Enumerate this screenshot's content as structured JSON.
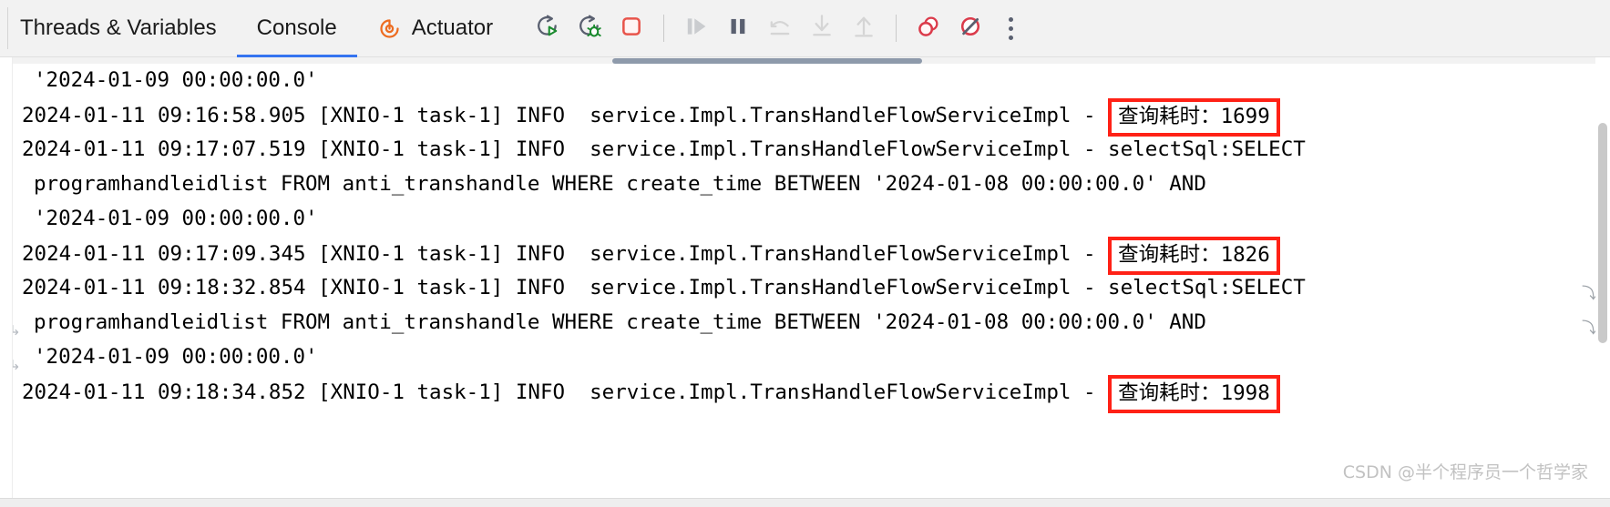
{
  "toolbar": {
    "tabs": [
      {
        "label": "Threads & Variables",
        "icon": null,
        "active": false
      },
      {
        "label": "Console",
        "icon": null,
        "active": true
      },
      {
        "label": "Actuator",
        "icon": "actuator-icon",
        "active": false
      }
    ],
    "actions": [
      {
        "name": "rerun-icon",
        "title": "Rerun"
      },
      {
        "name": "rerun-debug-icon",
        "title": "Rerun Debug"
      },
      {
        "name": "stop-icon",
        "title": "Stop"
      },
      {
        "name": "resume-program-icon",
        "title": "Resume Program"
      },
      {
        "name": "pause-program-icon",
        "title": "Pause Program"
      },
      {
        "name": "step-over-icon",
        "title": "Step Over"
      },
      {
        "name": "step-into-icon",
        "title": "Step Into"
      },
      {
        "name": "step-out-icon",
        "title": "Step Out"
      },
      {
        "name": "view-breakpoints-icon",
        "title": "View Breakpoints"
      },
      {
        "name": "mute-breakpoints-icon",
        "title": "Mute Breakpoints"
      },
      {
        "name": "more-options-icon",
        "title": "More"
      }
    ],
    "colors": {
      "accent_blue": "#3574f0",
      "actuator_orange": "#ed6c20",
      "run_green": "#1a8a2e",
      "stop_red": "#e8544b",
      "breakpoint_red": "#db3b4b",
      "toolbar_bg": "#f2f2f2"
    }
  },
  "console": {
    "highlight_color": "#ff2116",
    "lines": [
      {
        "id": "l1",
        "indent": 1,
        "segments": [
          {
            "type": "text",
            "value": "'2024-01-09 00:00:00.0'"
          }
        ]
      },
      {
        "id": "l2",
        "indent": 0,
        "segments": [
          {
            "type": "text",
            "value": "2024-01-11 09:16:58.905 [XNIO-1 task-1] INFO  service.Impl.TransHandleFlowServiceImpl - "
          },
          {
            "type": "highlight",
            "value": "查询耗时：1699"
          }
        ]
      },
      {
        "id": "l3",
        "indent": 0,
        "segments": [
          {
            "type": "text",
            "value": "2024-01-11 09:17:07.519 [XNIO-1 task-1] INFO  service.Impl.TransHandleFlowServiceImpl - selectSql:SELECT"
          }
        ]
      },
      {
        "id": "l4",
        "indent": 1,
        "segments": [
          {
            "type": "text",
            "value": "programhandleidlist FROM anti_transhandle WHERE create_time BETWEEN '2024-01-08 00:00:00.0' AND"
          }
        ]
      },
      {
        "id": "l5",
        "indent": 1,
        "segments": [
          {
            "type": "text",
            "value": "'2024-01-09 00:00:00.0'"
          }
        ]
      },
      {
        "id": "l6",
        "indent": 0,
        "segments": [
          {
            "type": "text",
            "value": "2024-01-11 09:17:09.345 [XNIO-1 task-1] INFO  service.Impl.TransHandleFlowServiceImpl - "
          },
          {
            "type": "highlight",
            "value": "查询耗时：1826"
          }
        ]
      },
      {
        "id": "l7",
        "indent": 0,
        "wrap_right": true,
        "segments": [
          {
            "type": "text",
            "value": "2024-01-11 09:18:32.854 [XNIO-1 task-1] INFO  service.Impl.TransHandleFlowServiceImpl - selectSql:SELECT"
          }
        ]
      },
      {
        "id": "l8",
        "indent": 1,
        "wrap_left": true,
        "wrap_right": true,
        "segments": [
          {
            "type": "text",
            "value": "programhandleidlist FROM anti_transhandle WHERE create_time BETWEEN '2024-01-08 00:00:00.0' AND"
          }
        ]
      },
      {
        "id": "l9",
        "indent": 1,
        "wrap_left": true,
        "segments": [
          {
            "type": "text",
            "value": "'2024-01-09 00:00:00.0'"
          }
        ]
      },
      {
        "id": "l10",
        "indent": 0,
        "segments": [
          {
            "type": "text",
            "value": "2024-01-11 09:18:34.852 [XNIO-1 task-1] INFO  service.Impl.TransHandleFlowServiceImpl - "
          },
          {
            "type": "highlight",
            "value": "查询耗时：1998"
          }
        ]
      }
    ]
  },
  "watermark": {
    "text": "CSDN @半个程序员一个哲学家"
  }
}
